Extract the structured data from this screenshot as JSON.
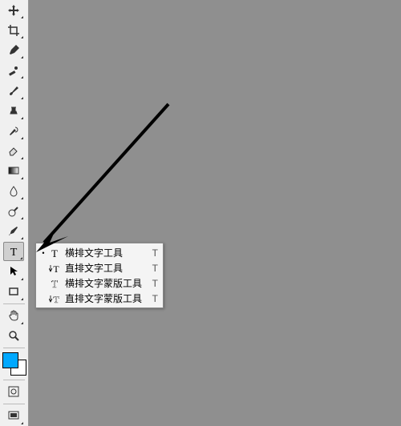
{
  "flyout": {
    "items": [
      {
        "label": "横排文字工具",
        "shortcut": "T",
        "selected": true
      },
      {
        "label": "直排文字工具",
        "shortcut": "T",
        "selected": false
      },
      {
        "label": "横排文字蒙版工具",
        "shortcut": "T",
        "selected": false
      },
      {
        "label": "直排文字蒙版工具",
        "shortcut": "T",
        "selected": false
      }
    ]
  },
  "colors": {
    "foreground": "#00a8ff",
    "background": "#ffffff"
  }
}
